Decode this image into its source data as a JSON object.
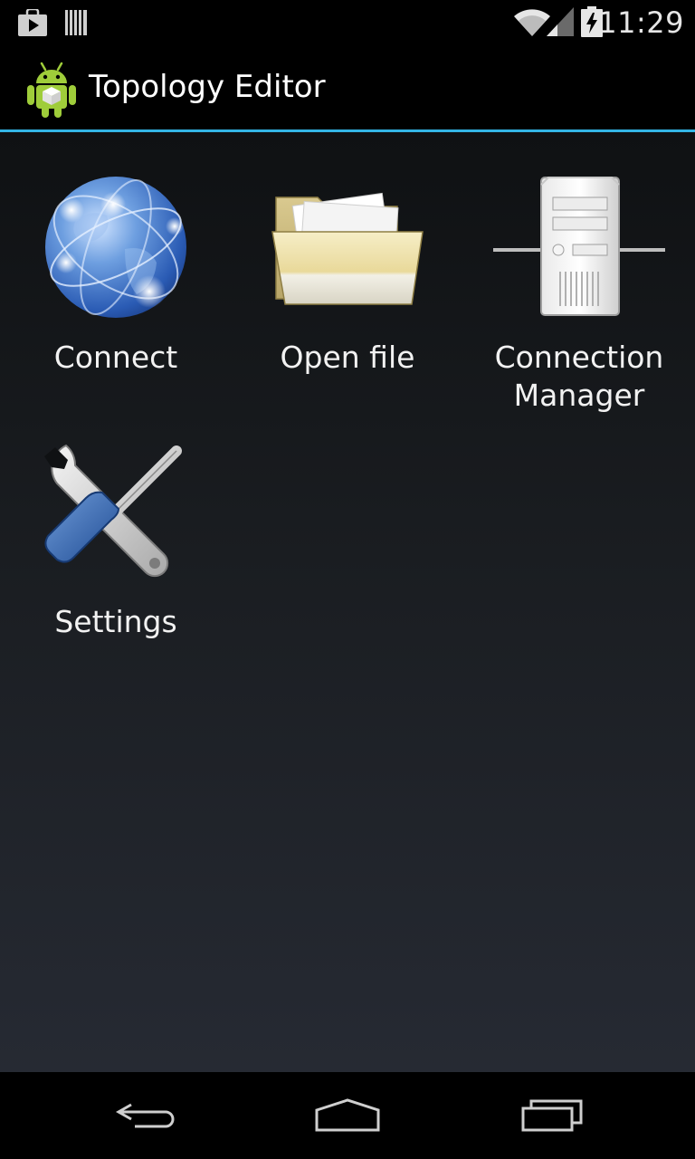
{
  "status_bar": {
    "time": "11:29",
    "icons": [
      "play-store-notification-icon",
      "barcode-notification-icon",
      "wifi-icon",
      "cell-signal-icon",
      "battery-charging-icon"
    ]
  },
  "action_bar": {
    "title": "Topology Editor",
    "app_icon": "android-app-icon",
    "accent_color": "#33b5e5"
  },
  "menu": {
    "items": [
      {
        "label": "Connect",
        "icon": "globe-icon"
      },
      {
        "label": "Open file",
        "icon": "folder-icon"
      },
      {
        "label": "Connection Manager",
        "icon": "server-icon"
      },
      {
        "label": "Settings",
        "icon": "tools-icon"
      }
    ]
  },
  "nav_bar": {
    "buttons": [
      "back-icon",
      "home-icon",
      "recent-apps-icon"
    ]
  }
}
